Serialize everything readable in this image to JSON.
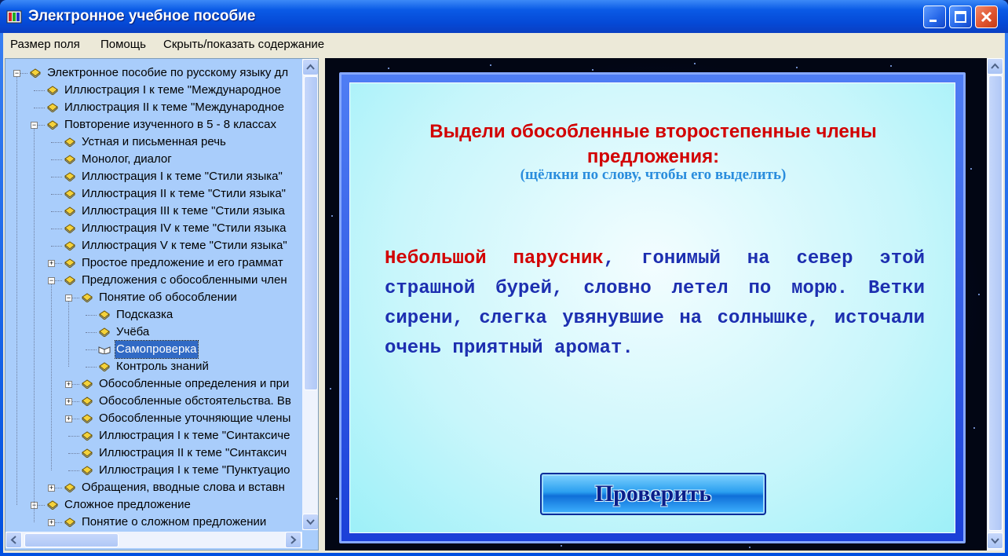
{
  "window": {
    "title": "Электронное учебное пособие",
    "title_color": "#0a5ae6"
  },
  "menu": {
    "items": [
      {
        "label": "Размер поля"
      },
      {
        "label": "Помощь"
      },
      {
        "label": "Скрыть/показать содержание"
      }
    ]
  },
  "tree": {
    "nodes": [
      {
        "label": "Электронное пособие по русскому языку дл",
        "level": 0,
        "expander": "minus",
        "icon": "book-closed-icon"
      },
      {
        "label": "Иллюстрация I к теме \"Международное",
        "level": 1,
        "expander": "",
        "icon": "book-closed-icon"
      },
      {
        "label": "Иллюстрация II к теме \"Международное",
        "level": 1,
        "expander": "",
        "icon": "book-closed-icon"
      },
      {
        "label": "Повторение изученного в 5 - 8 классах",
        "level": 1,
        "expander": "minus",
        "icon": "book-closed-icon"
      },
      {
        "label": "Устная и письменная речь",
        "level": 2,
        "expander": "",
        "icon": "book-closed-icon"
      },
      {
        "label": "Монолог, диалог",
        "level": 2,
        "expander": "",
        "icon": "book-closed-icon"
      },
      {
        "label": "Иллюстрация I к теме \"Стили языка\"",
        "level": 2,
        "expander": "",
        "icon": "book-closed-icon"
      },
      {
        "label": "Иллюстрация II к теме \"Стили языка\"",
        "level": 2,
        "expander": "",
        "icon": "book-closed-icon"
      },
      {
        "label": "Иллюстрация III к теме \"Стили языка",
        "level": 2,
        "expander": "",
        "icon": "book-closed-icon"
      },
      {
        "label": "Иллюстрация IV к теме \"Стили языка",
        "level": 2,
        "expander": "",
        "icon": "book-closed-icon"
      },
      {
        "label": "Иллюстрация V к теме \"Стили языка\"",
        "level": 2,
        "expander": "",
        "icon": "book-closed-icon"
      },
      {
        "label": "Простое предложение и его граммат",
        "level": 2,
        "expander": "plus",
        "icon": "book-closed-icon"
      },
      {
        "label": "Предложения с обособленными член",
        "level": 2,
        "expander": "minus",
        "icon": "book-closed-icon"
      },
      {
        "label": "Понятие об обособлении",
        "level": 3,
        "expander": "minus",
        "icon": "book-closed-icon"
      },
      {
        "label": "Подсказка",
        "level": 4,
        "expander": "",
        "icon": "book-closed-icon"
      },
      {
        "label": "Учёба",
        "level": 4,
        "expander": "",
        "icon": "book-closed-icon"
      },
      {
        "label": "Самопроверка",
        "level": 4,
        "expander": "",
        "icon": "book-open-icon",
        "selected": true
      },
      {
        "label": "Контроль знаний",
        "level": 4,
        "expander": "",
        "icon": "book-closed-icon"
      },
      {
        "label": "Обособленные определения и при",
        "level": 3,
        "expander": "plus",
        "icon": "book-closed-icon"
      },
      {
        "label": "Обособленные обстоятельства. Вв",
        "level": 3,
        "expander": "plus",
        "icon": "book-closed-icon"
      },
      {
        "label": "Обособленные уточняющие члены",
        "level": 3,
        "expander": "plus",
        "icon": "book-closed-icon"
      },
      {
        "label": "Иллюстрация I к теме \"Синтаксиче",
        "level": 3,
        "expander": "",
        "icon": "book-closed-icon"
      },
      {
        "label": "Иллюстрация II к теме \"Синтаксич",
        "level": 3,
        "expander": "",
        "icon": "book-closed-icon"
      },
      {
        "label": "Иллюстрация I к теме \"Пунктуацио",
        "level": 3,
        "expander": "",
        "icon": "book-closed-icon"
      },
      {
        "label": "Обращения, вводные слова и вставн",
        "level": 2,
        "expander": "plus",
        "icon": "book-closed-icon"
      },
      {
        "label": "Сложное предложение",
        "level": 1,
        "expander": "minus",
        "icon": "book-closed-icon"
      },
      {
        "label": "Понятие о сложном предложении",
        "level": 2,
        "expander": "plus",
        "icon": "book-closed-icon"
      }
    ]
  },
  "exercise": {
    "title": "Выдели обособленные второстепенные члены предложения:",
    "hint": "(щёлкни по слову, чтобы его выделить)",
    "passage": [
      {
        "text": "Небольшой",
        "selected": true
      },
      {
        "text": " ",
        "selected": false
      },
      {
        "text": "парусник",
        "selected": true
      },
      {
        "text": ", гонимый на север этой страшной бурей, словно летел по морю. Ветки сирени, слегка увянувшие на солнышке, источали очень приятный аромат.",
        "selected": false
      }
    ],
    "check_button": "Проверить",
    "colors": {
      "selected": "#d20000",
      "text": "#1d2fb0",
      "hint": "#2a8ddd"
    }
  }
}
